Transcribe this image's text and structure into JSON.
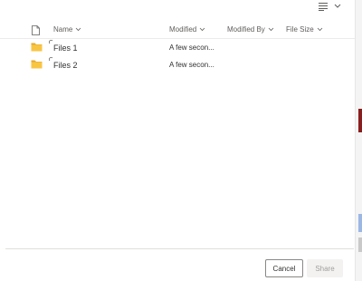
{
  "toolbar": {
    "view_icon": "list-view-icon",
    "chevron_icon": "chevron-down-icon"
  },
  "columns": {
    "file_type_icon": "file-icon",
    "name": "Name",
    "modified": "Modified",
    "modified_by": "Modified By",
    "file_size": "File Size"
  },
  "rows": [
    {
      "name": "Files 1",
      "modified": "A few secon...",
      "icon": "folder-icon"
    },
    {
      "name": "Files 2",
      "modified": "A few secon...",
      "icon": "folder-icon"
    }
  ],
  "footer": {
    "cancel_label": "Cancel",
    "share_label": "Share"
  },
  "colors": {
    "folder": "#f8c543",
    "folder_tab": "#e6aa2b",
    "border": "#8a8886",
    "disabled_bg": "#f3f2f1",
    "disabled_text": "#a19f9d"
  }
}
